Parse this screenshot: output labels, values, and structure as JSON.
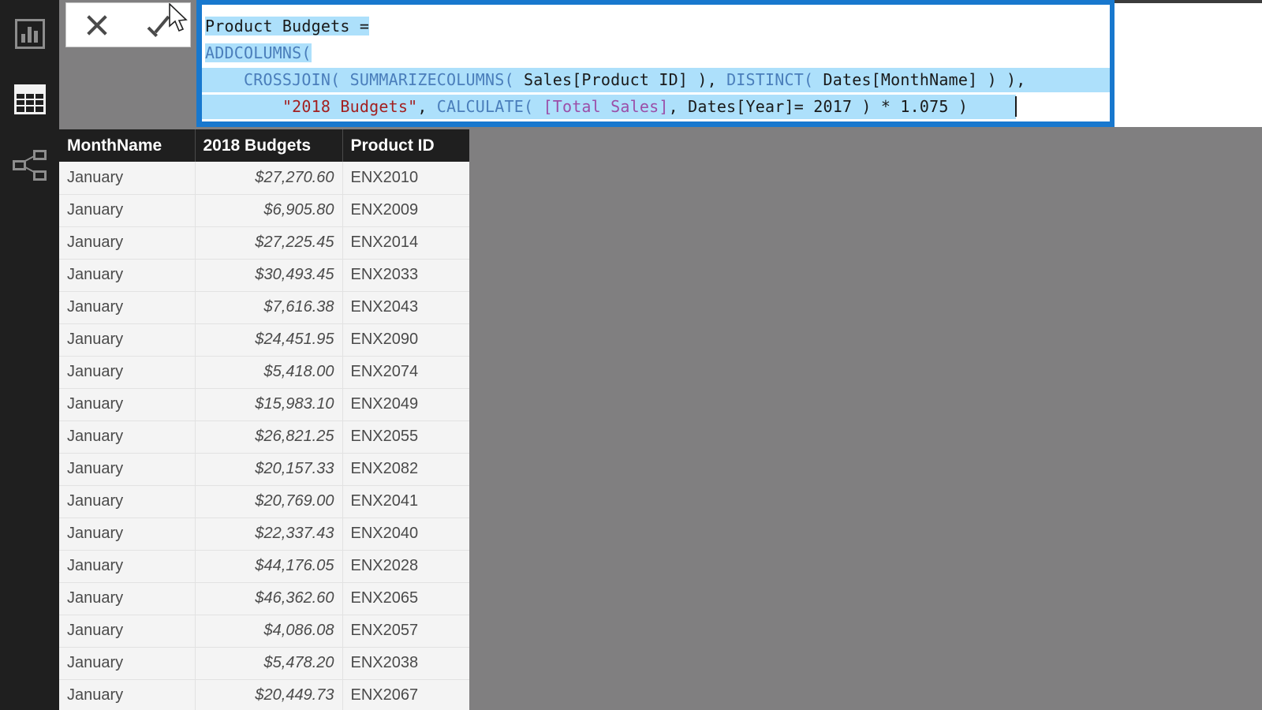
{
  "nav": {
    "items": [
      {
        "icon": "report-view-icon",
        "label": "Report view",
        "active": false
      },
      {
        "icon": "data-view-icon",
        "label": "Data view",
        "active": true
      },
      {
        "icon": "model-view-icon",
        "label": "Model view",
        "active": false
      }
    ]
  },
  "formula_toolbar": {
    "cancel_label": "✕",
    "commit_label": "✓",
    "cancel_name": "Cancel",
    "commit_name": "Commit"
  },
  "formula": {
    "measure_name": "Product Budgets",
    "full_text": "Product Budgets =\nADDCOLUMNS(\n    CROSSJOIN( SUMMARIZECOLUMNS( Sales[Product ID] ), DISTINCT( Dates[MonthName] ) ),\n        \"2018 Budgets\", CALCULATE( [Total Sales], Dates[Year]= 2017 ) * 1.075 )",
    "lines": [
      {
        "selected_text": "Product Budgets =",
        "trailing": ""
      },
      {
        "fn": "ADDCOLUMNS(",
        "trailing": ""
      },
      {
        "indent": "    ",
        "fn1": "CROSSJOIN(",
        "sp1": " ",
        "fn2": "SUMMARIZECOLUMNS(",
        "arg1": " Sales[Product ID] ), ",
        "fn3": "DISTINCT(",
        "arg2": " Dates[MonthName] ) ),"
      },
      {
        "indent": "        ",
        "str": "\"2018 Budgets\"",
        "comma": ", ",
        "fn": "CALCULATE(",
        "sp": " ",
        "measure": "[Total Sales]",
        "rest": ", Dates[Year]= 2017 ) * 1.075 )"
      }
    ],
    "colors": {
      "function": "#4a7ebb",
      "string": "#a32020",
      "measure": "#9b4fa8",
      "text": "#1a1a1a",
      "selection": "#ade0fb",
      "border": "#1878ce"
    }
  },
  "table": {
    "columns": [
      "MonthName",
      "2018 Budgets",
      "Product ID"
    ],
    "rows": [
      {
        "month": "January",
        "budget": "$27,270.60",
        "product_id": "ENX2010"
      },
      {
        "month": "January",
        "budget": "$6,905.80",
        "product_id": "ENX2009"
      },
      {
        "month": "January",
        "budget": "$27,225.45",
        "product_id": "ENX2014"
      },
      {
        "month": "January",
        "budget": "$30,493.45",
        "product_id": "ENX2033"
      },
      {
        "month": "January",
        "budget": "$7,616.38",
        "product_id": "ENX2043"
      },
      {
        "month": "January",
        "budget": "$24,451.95",
        "product_id": "ENX2090"
      },
      {
        "month": "January",
        "budget": "$5,418.00",
        "product_id": "ENX2074"
      },
      {
        "month": "January",
        "budget": "$15,983.10",
        "product_id": "ENX2049"
      },
      {
        "month": "January",
        "budget": "$26,821.25",
        "product_id": "ENX2055"
      },
      {
        "month": "January",
        "budget": "$20,157.33",
        "product_id": "ENX2082"
      },
      {
        "month": "January",
        "budget": "$20,769.00",
        "product_id": "ENX2041"
      },
      {
        "month": "January",
        "budget": "$22,337.43",
        "product_id": "ENX2040"
      },
      {
        "month": "January",
        "budget": "$44,176.05",
        "product_id": "ENX2028"
      },
      {
        "month": "January",
        "budget": "$46,362.60",
        "product_id": "ENX2065"
      },
      {
        "month": "January",
        "budget": "$4,086.08",
        "product_id": "ENX2057"
      },
      {
        "month": "January",
        "budget": "$5,478.20",
        "product_id": "ENX2038"
      },
      {
        "month": "January",
        "budget": "$20,449.73",
        "product_id": "ENX2067"
      }
    ]
  },
  "theme": {
    "canvas_background": "#807f80",
    "nav_background": "#1f1f1f",
    "header_background": "#1f1f1f",
    "row_background": "#f4f4f4",
    "accent_blue": "#1878ce"
  }
}
